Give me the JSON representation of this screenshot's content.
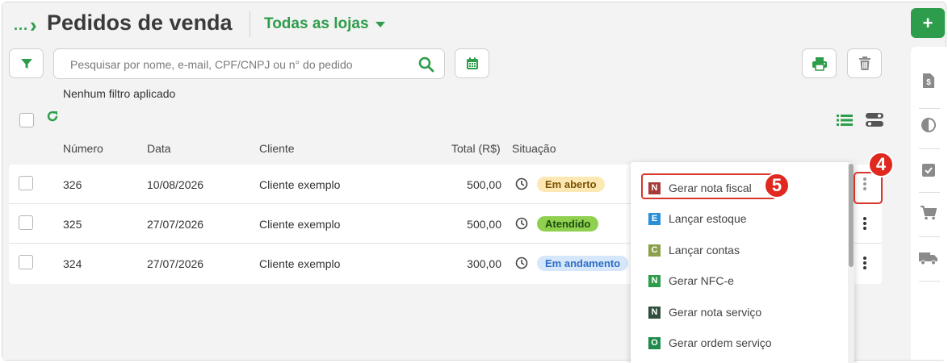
{
  "header": {
    "breadcrumb_dots": "...",
    "title": "Pedidos de venda",
    "store_filter": "Todas as lojas"
  },
  "toolbar": {
    "search_placeholder": "Pesquisar por nome, e-mail, CPF/CNPJ ou n° do pedido",
    "filter_status": "Nenhum filtro aplicado"
  },
  "table": {
    "columns": {
      "numero": "Número",
      "data": "Data",
      "cliente": "Cliente",
      "total": "Total (R$)",
      "situacao": "Situação"
    },
    "rows": [
      {
        "numero": "326",
        "data": "10/08/2026",
        "cliente": "Cliente exemplo",
        "total": "500,00",
        "situacao": "Em aberto"
      },
      {
        "numero": "325",
        "data": "27/07/2026",
        "cliente": "Cliente exemplo",
        "total": "500,00",
        "situacao": "Atendido"
      },
      {
        "numero": "324",
        "data": "27/07/2026",
        "cliente": "Cliente exemplo",
        "total": "300,00",
        "situacao": "Em andamento"
      }
    ]
  },
  "status_colors": {
    "em_aberto": {
      "bg": "#fde8b4",
      "fg": "#7a5200"
    },
    "atendido": {
      "bg": "#8fd14f",
      "fg": "#1f4d0f"
    },
    "em_andamento": {
      "bg": "#d6e7fb",
      "fg": "#2f6fc4"
    }
  },
  "actions_menu": {
    "items": [
      {
        "icon": "N",
        "label": "Gerar nota fiscal",
        "color": "#a83a3a"
      },
      {
        "icon": "E",
        "label": "Lançar estoque",
        "color": "#2a8fd6"
      },
      {
        "icon": "C",
        "label": "Lançar contas",
        "color": "#8aa04a"
      },
      {
        "icon": "N",
        "label": "Gerar NFC-e",
        "color": "#2e9d4b"
      },
      {
        "icon": "N",
        "label": "Gerar nota serviço",
        "color": "#2f4f3a"
      },
      {
        "icon": "O",
        "label": "Gerar ordem serviço",
        "color": "#1f8a4a"
      }
    ]
  },
  "annotations": {
    "step_kebab": "4",
    "step_item": "5"
  },
  "colors": {
    "accent": "#2e9d4b",
    "highlight": "#d9362b"
  },
  "right_rail": {
    "add_label": "+",
    "icons": [
      "invoice-icon",
      "contrast-icon",
      "checkbox-icon",
      "cart-icon",
      "truck-icon"
    ]
  }
}
